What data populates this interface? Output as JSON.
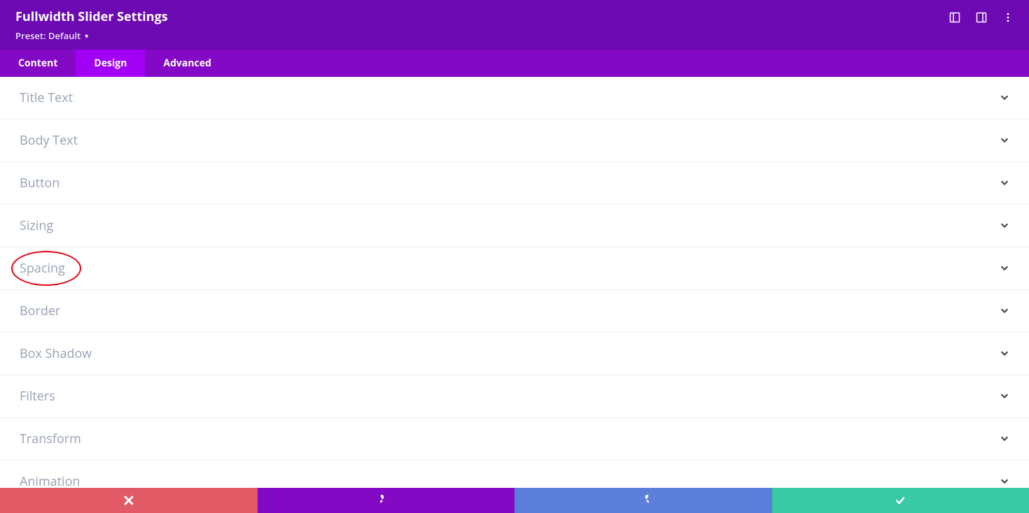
{
  "header": {
    "title": "Fullwidth Slider Settings",
    "preset_label": "Preset: Default"
  },
  "tabs": [
    {
      "label": "Content",
      "active": false
    },
    {
      "label": "Design",
      "active": true
    },
    {
      "label": "Advanced",
      "active": false
    }
  ],
  "accordion": [
    {
      "label": "Title Text",
      "highlighted": false
    },
    {
      "label": "Body Text",
      "highlighted": false
    },
    {
      "label": "Button",
      "highlighted": false
    },
    {
      "label": "Sizing",
      "highlighted": false
    },
    {
      "label": "Spacing",
      "highlighted": true
    },
    {
      "label": "Border",
      "highlighted": false
    },
    {
      "label": "Box Shadow",
      "highlighted": false
    },
    {
      "label": "Filters",
      "highlighted": false
    },
    {
      "label": "Transform",
      "highlighted": false
    },
    {
      "label": "Animation",
      "highlighted": false
    }
  ],
  "colors": {
    "header_bg": "#6c09b3",
    "tabs_bg": "#8409c4",
    "tab_active_bg": "#a200f4",
    "cancel": "#e25a65",
    "undo": "#8409c4",
    "redo": "#5b7fdb",
    "save": "#39c9a5",
    "highlight_stroke": "#e30613"
  }
}
